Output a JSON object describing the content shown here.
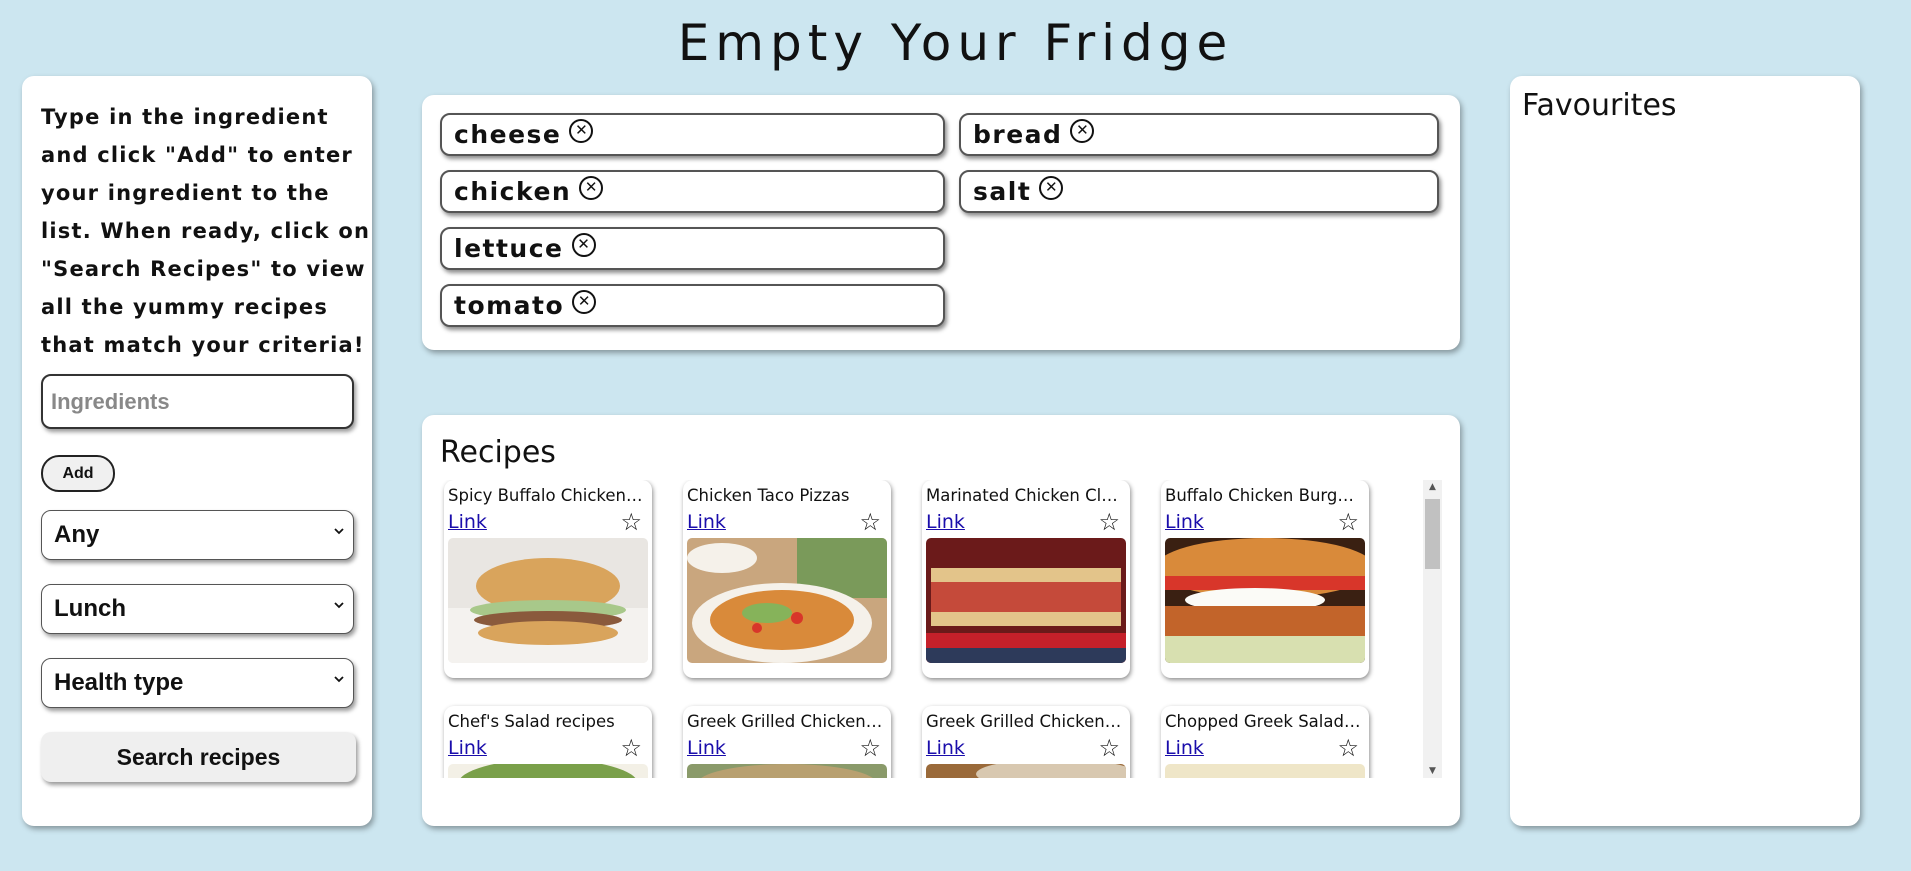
{
  "page": {
    "title": "Empty Your Fridge"
  },
  "sidebar": {
    "instructions": "Type in the ingredient and click \"Add\" to enter your ingredient to the list. When ready, click on \"Search Recipes\" to view all the yummy recipes that match your criteria!",
    "ingredient_placeholder": "Ingredients",
    "add_label": "Add",
    "cuisine_selected": "Any",
    "meal_selected": "Lunch",
    "health_selected": "Health type",
    "search_label": "Search recipes"
  },
  "ingredients": [
    {
      "label": "cheese"
    },
    {
      "label": "bread"
    },
    {
      "label": "chicken"
    },
    {
      "label": "salt"
    },
    {
      "label": "lettuce"
    },
    {
      "label": "tomato"
    }
  ],
  "recipes": {
    "heading": "Recipes",
    "link_label": "Link",
    "cards": [
      {
        "name": "Spicy Buffalo Chicken Burgers"
      },
      {
        "name": "Chicken Taco Pizzas"
      },
      {
        "name": "Marinated Chicken Club Sandwich"
      },
      {
        "name": "Buffalo Chicken Burgers"
      },
      {
        "name": "Chef's Salad recipes"
      },
      {
        "name": "Greek Grilled Chicken Salad"
      },
      {
        "name": "Greek Grilled Chicken Pita"
      },
      {
        "name": "Chopped Greek Salad with Chicken"
      }
    ]
  },
  "favourites": {
    "heading": "Favourites"
  },
  "colors": {
    "background": "#cce6f0",
    "link": "#1a0dab",
    "panel": "#ffffff"
  },
  "icons": {
    "remove": "circle-x-icon",
    "favourite": "star-outline-icon",
    "dropdown": "chevron-down-icon"
  }
}
